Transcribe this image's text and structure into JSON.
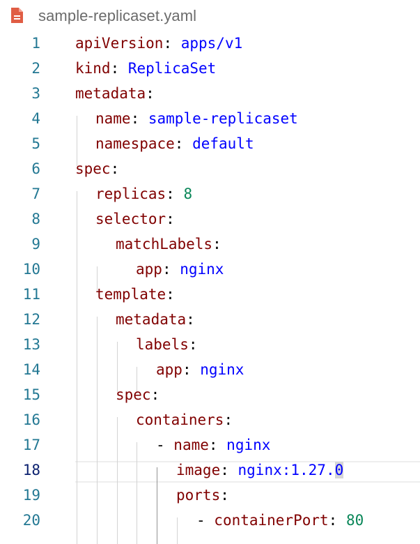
{
  "tab": {
    "title": "sample-replicaset.yaml",
    "icon": "yaml-file-icon",
    "icon_color": "#e05d44"
  },
  "editor": {
    "active_line": 18,
    "lines": [
      {
        "n": "1",
        "key": "apiVersion",
        "sep": ": ",
        "val": "apps/v1"
      },
      {
        "n": "2",
        "key": "kind",
        "sep": ": ",
        "val": "ReplicaSet"
      },
      {
        "n": "3",
        "key": "metadata",
        "sep": ":"
      },
      {
        "n": "4",
        "key": "name",
        "sep": ": ",
        "val": "sample-replicaset"
      },
      {
        "n": "5",
        "key": "namespace",
        "sep": ": ",
        "val": "default"
      },
      {
        "n": "6",
        "key": "spec",
        "sep": ":"
      },
      {
        "n": "7",
        "key": "replicas",
        "sep": ": ",
        "num": "8"
      },
      {
        "n": "8",
        "key": "selector",
        "sep": ":"
      },
      {
        "n": "9",
        "key": "matchLabels",
        "sep": ":"
      },
      {
        "n": "10",
        "key": "app",
        "sep": ": ",
        "val": "nginx"
      },
      {
        "n": "11",
        "key": "template",
        "sep": ":"
      },
      {
        "n": "12",
        "key": "metadata",
        "sep": ":"
      },
      {
        "n": "13",
        "key": "labels",
        "sep": ":"
      },
      {
        "n": "14",
        "key": "app",
        "sep": ": ",
        "val": "nginx"
      },
      {
        "n": "15",
        "key": "spec",
        "sep": ":"
      },
      {
        "n": "16",
        "key": "containers",
        "sep": ":"
      },
      {
        "n": "17",
        "dash": "- ",
        "key": "name",
        "sep": ": ",
        "val": "nginx"
      },
      {
        "n": "18",
        "key": "image",
        "sep": ": ",
        "val": "nginx:1.27.",
        "sel": "0"
      },
      {
        "n": "19",
        "key": "ports",
        "sep": ":"
      },
      {
        "n": "20",
        "dash": "- ",
        "key": "containerPort",
        "sep": ": ",
        "num": "80"
      }
    ]
  }
}
